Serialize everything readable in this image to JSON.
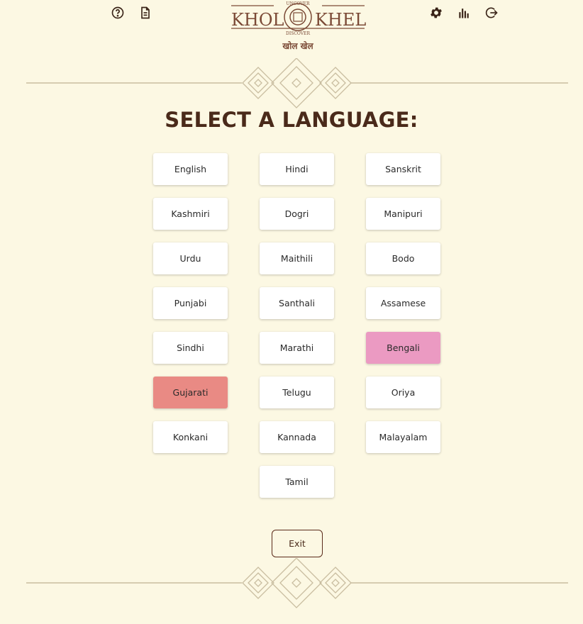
{
  "header": {
    "logo_text_left": "KHOL",
    "logo_text_right": "KHEL",
    "logo_arc_top": "UNCOVER",
    "logo_arc_bottom": "DISCOVER",
    "logo_subtitle": "खोल खेल",
    "icons": [
      "help-circle-icon",
      "document-icon",
      "gear-icon",
      "bar-chart-icon",
      "logout-icon"
    ]
  },
  "main": {
    "title": "SELECT A LANGUAGE:",
    "languages": [
      {
        "label": "English"
      },
      {
        "label": "Hindi"
      },
      {
        "label": "Sanskrit"
      },
      {
        "label": "Kashmiri"
      },
      {
        "label": "Dogri"
      },
      {
        "label": "Manipuri"
      },
      {
        "label": "Urdu"
      },
      {
        "label": "Maithili"
      },
      {
        "label": "Bodo"
      },
      {
        "label": "Punjabi"
      },
      {
        "label": "Santhali"
      },
      {
        "label": "Assamese"
      },
      {
        "label": "Sindhi"
      },
      {
        "label": "Marathi"
      },
      {
        "label": "Bengali",
        "highlight": "#eb9ac2"
      },
      {
        "label": "Gujarati",
        "highlight": "#e98a84"
      },
      {
        "label": "Telugu"
      },
      {
        "label": "Oriya"
      },
      {
        "label": "Konkani"
      },
      {
        "label": "Kannada"
      },
      {
        "label": "Malayalam"
      },
      {
        "label": "Tamil"
      }
    ],
    "exit_label": "Exit"
  },
  "colors": {
    "background": "#fcf8e3",
    "text": "#4a2a1a",
    "ornament": "#cfc3a6",
    "bengali_highlight": "#eb9ac2",
    "gujarati_highlight": "#e98a84"
  }
}
